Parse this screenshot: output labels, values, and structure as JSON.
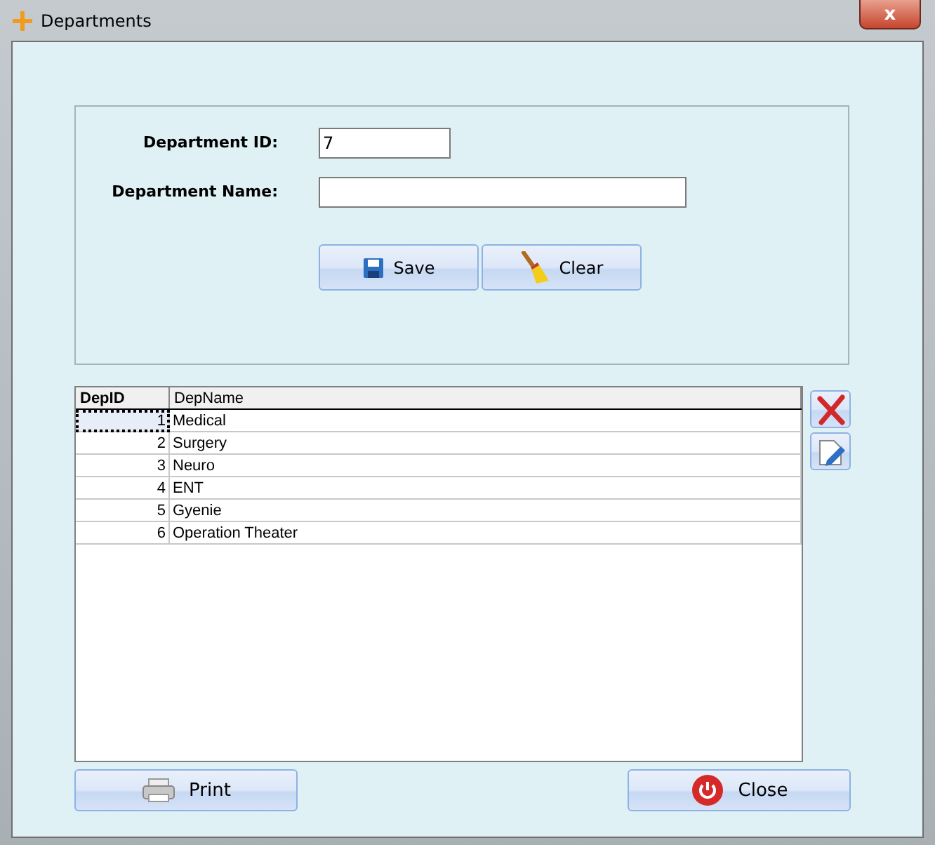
{
  "window": {
    "title": "Departments",
    "close_label": "x"
  },
  "form": {
    "fields": [
      {
        "label": "Department ID:",
        "value": "7",
        "kind": "short"
      },
      {
        "label": "Department Name:",
        "kind": "long"
      }
    ],
    "buttons": [
      {
        "label": "Save",
        "kind": "save"
      },
      {
        "label": "Clear",
        "kind": "clear"
      }
    ]
  },
  "table": {
    "columns": [
      "DepID",
      "DepName"
    ],
    "rows": [
      {
        "cells": [
          "1",
          "Medical"
        ],
        "selected": true
      },
      {
        "cells": [
          "2",
          "Surgery"
        ],
        "selected": false
      },
      {
        "cells": [
          "3",
          "Neuro"
        ],
        "selected": false
      },
      {
        "cells": [
          "4",
          "ENT"
        ],
        "selected": false
      },
      {
        "cells": [
          "5",
          "Gyenie"
        ],
        "selected": false
      },
      {
        "cells": [
          "6",
          "Operation Theater"
        ],
        "selected": false
      }
    ]
  },
  "side_buttons": [
    {
      "kind": "delete"
    },
    {
      "kind": "edit"
    }
  ],
  "bottom_buttons": [
    {
      "label": "Print",
      "kind": "print"
    },
    {
      "label": "Close",
      "kind": "close"
    }
  ]
}
